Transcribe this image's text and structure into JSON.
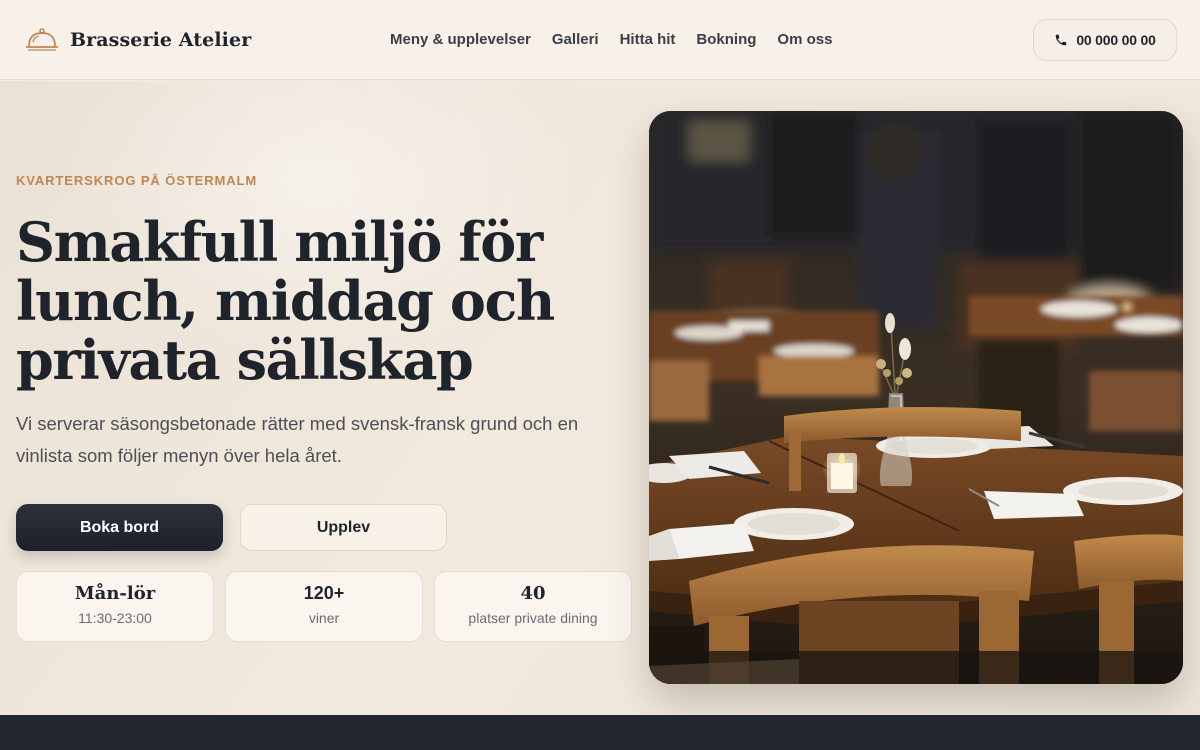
{
  "brand": {
    "name": "Brasserie Atelier",
    "icon": "cloche-icon"
  },
  "nav": {
    "items": [
      {
        "label": "Meny & upplevelser"
      },
      {
        "label": "Galleri"
      },
      {
        "label": "Hitta hit"
      },
      {
        "label": "Bokning"
      },
      {
        "label": "Om oss"
      }
    ]
  },
  "header": {
    "phone": "00 000 00 00",
    "phone_icon": "phone-icon"
  },
  "hero": {
    "eyebrow": "KVARTERSKROG PÅ ÖSTERMALM",
    "title": "Smakfull miljö för lunch, middag och privata sällskap",
    "lead": "Vi serverar säsongsbetonade rätter med svensk-fransk grund och en vinlista som följer menyn över hela året.",
    "primary_cta": "Boka bord",
    "secondary_cta": "Upplev",
    "stats": [
      {
        "value": "Mån-lör",
        "label": "11:30-23:00"
      },
      {
        "value": "120+",
        "label": "viner"
      },
      {
        "value": "40",
        "label": "platser private dining"
      }
    ]
  },
  "colors": {
    "accent": "#c08652",
    "dark": "#1f242c",
    "background": "#f3ebe1",
    "footer": "#222730"
  }
}
